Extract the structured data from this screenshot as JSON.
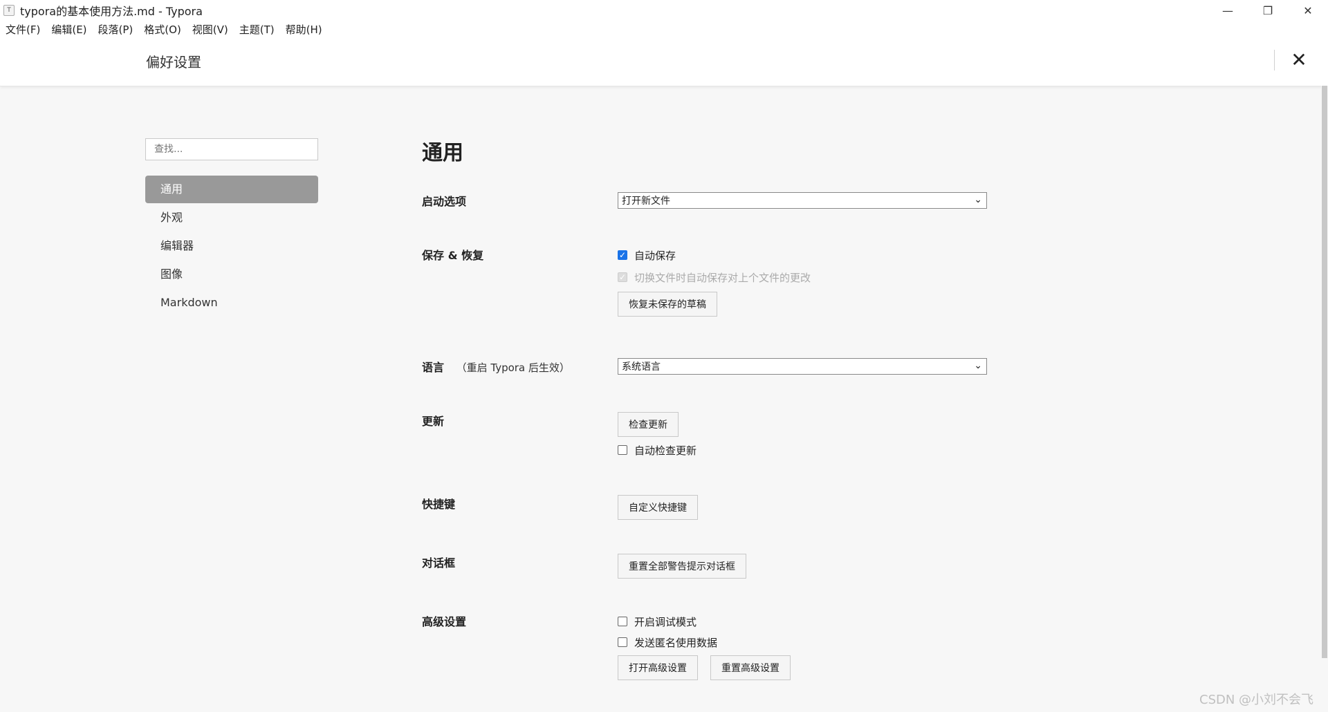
{
  "window": {
    "icon_glyph": "T",
    "title": "typora的基本使用方法.md - Typora",
    "controls": {
      "minimize": "—",
      "restore": "❐",
      "close": "✕"
    }
  },
  "menu": {
    "items": [
      "文件(F)",
      "编辑(E)",
      "段落(P)",
      "格式(O)",
      "视图(V)",
      "主题(T)",
      "帮助(H)"
    ]
  },
  "preferences": {
    "title": "偏好设置",
    "close_glyph": "✕"
  },
  "sidebar": {
    "search_placeholder": "查找...",
    "items": [
      {
        "label": "通用",
        "active": true
      },
      {
        "label": "外观"
      },
      {
        "label": "编辑器"
      },
      {
        "label": "图像"
      },
      {
        "label": "Markdown"
      }
    ]
  },
  "general": {
    "title": "通用",
    "startup": {
      "label": "启动选项",
      "selected": "打开新文件"
    },
    "save_restore": {
      "label": "保存 & 恢复",
      "autosave_label": "自动保存",
      "autosave_checked": true,
      "switch_save_label": "切换文件时自动保存对上个文件的更改",
      "switch_save_checked": true,
      "restore_button": "恢复未保存的草稿"
    },
    "language": {
      "label": "语言",
      "note": "（重启 Typora 后生效）",
      "selected": "系统语言"
    },
    "update": {
      "label": "更新",
      "check_button": "检查更新",
      "auto_check_label": "自动检查更新",
      "auto_check_checked": false
    },
    "shortcuts": {
      "label": "快捷键",
      "custom_button": "自定义快捷键"
    },
    "dialogs": {
      "label": "对话框",
      "reset_button": "重置全部警告提示对话框"
    },
    "advanced": {
      "label": "高级设置",
      "debug_label": "开启调试模式",
      "debug_checked": false,
      "anon_label": "发送匿名使用数据",
      "anon_checked": false,
      "open_button": "打开高级设置",
      "reset_button": "重置高级设置"
    }
  },
  "watermark": "CSDN @小刘不会飞"
}
